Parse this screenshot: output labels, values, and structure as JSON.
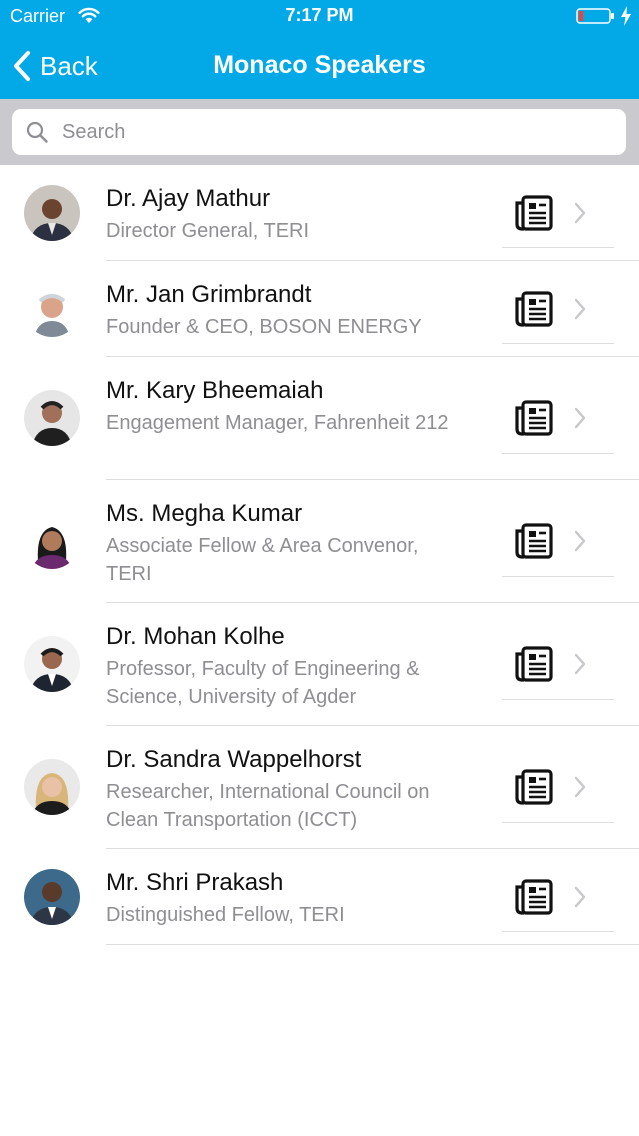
{
  "status_bar": {
    "carrier": "Carrier",
    "time": "7:17 PM"
  },
  "nav": {
    "back_label": "Back",
    "title": "Monaco Speakers"
  },
  "search": {
    "placeholder": "Search"
  },
  "colors": {
    "header_bg": "#03a9e6",
    "search_bar_bg": "#c9c9ce",
    "secondary_text": "#8e8e93",
    "battery_low": "#ff3b30"
  },
  "icons": {
    "wifi": "wifi-icon",
    "battery": "battery-icon",
    "charging": "charging-icon",
    "back": "chevron-left-icon",
    "search": "search-icon",
    "document": "document-icon",
    "disclosure": "chevron-right-icon"
  },
  "speakers": [
    {
      "name": "Dr. Ajay Mathur",
      "title": "Director General, TERI"
    },
    {
      "name": "Mr. Jan Grimbrandt",
      "title": "Founder & CEO, BOSON ENERGY"
    },
    {
      "name": "Mr. Kary Bheemaiah",
      "title": "Engagement Manager, Fahrenheit 212"
    },
    {
      "name": "Ms. Megha Kumar",
      "title": "Associate Fellow & Area Convenor, TERI"
    },
    {
      "name": "Dr. Mohan Kolhe",
      "title": "Professor, Faculty of Engineering & Science, University of Agder"
    },
    {
      "name": "Dr. Sandra Wappelhorst",
      "title": "Researcher, International Council on Clean Transportation (ICCT)"
    },
    {
      "name": "Mr. Shri Prakash",
      "title": "Distinguished Fellow, TERI"
    }
  ]
}
